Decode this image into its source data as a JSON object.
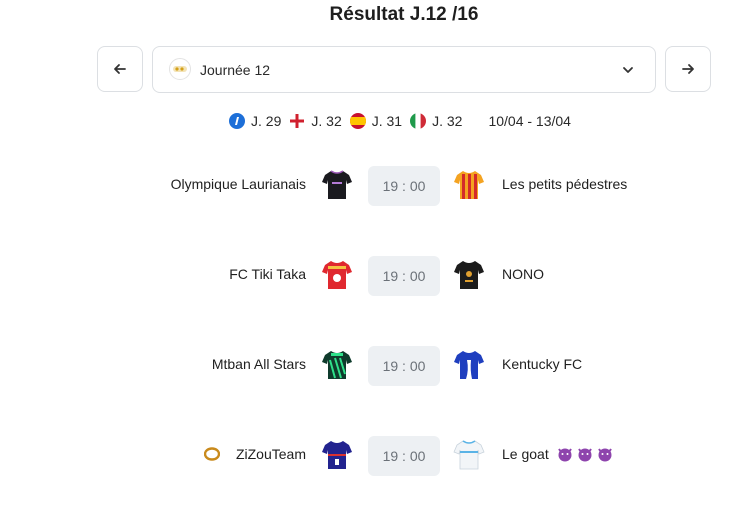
{
  "title": "Résultat J.12 /16",
  "selector": {
    "label": "Journée 12"
  },
  "info": {
    "leagues": [
      {
        "icon": "ligue1-icon",
        "label": "J. 29"
      },
      {
        "icon": "england-flag-icon",
        "label": "J. 32"
      },
      {
        "icon": "spain-flag-icon",
        "label": "J. 31"
      },
      {
        "icon": "italy-flag-icon",
        "label": "J. 32"
      }
    ],
    "dates": "10/04 - 13/04"
  },
  "matches": [
    {
      "home": "Olympique Laurianais",
      "time": "19 : 00",
      "away": "Les petits pédestres"
    },
    {
      "home": "FC Tiki Taka",
      "time": "19 : 00",
      "away": "NONO"
    },
    {
      "home": "Mtban All Stars",
      "time": "19 : 00",
      "away": "Kentucky FC"
    },
    {
      "home": "ZiZouTeam",
      "time": "19 : 00",
      "away": "Le goat"
    }
  ],
  "colors": {
    "time_bg": "#edf0f3",
    "border": "#dcdfe3"
  }
}
